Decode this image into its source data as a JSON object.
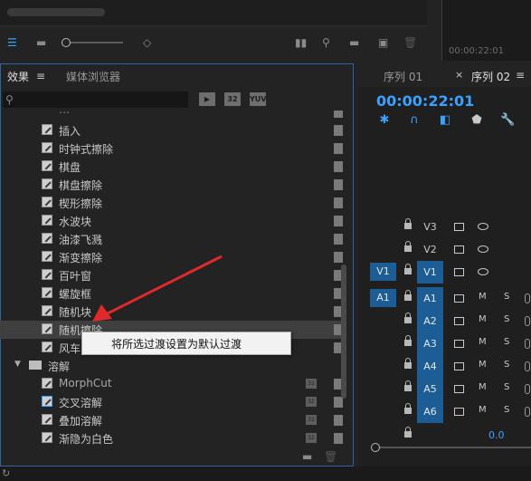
{
  "top": {
    "timecode_small": "00:00:22:01"
  },
  "effects_panel": {
    "tab_effects": "效果",
    "tab_media_browser": "媒体浏览器",
    "search_placeholder": "",
    "filter_buttons": [
      "32",
      "YUV"
    ],
    "items": [
      {
        "label": "插入"
      },
      {
        "label": "时钟式擦除"
      },
      {
        "label": "棋盘"
      },
      {
        "label": "棋盘擦除"
      },
      {
        "label": "楔形擦除"
      },
      {
        "label": "水波块"
      },
      {
        "label": "油漆飞溅"
      },
      {
        "label": "渐变擦除"
      },
      {
        "label": "百叶窗"
      },
      {
        "label": "螺旋框"
      },
      {
        "label": "随机块"
      },
      {
        "label": "随机擦除"
      },
      {
        "label": "风车"
      }
    ],
    "folder": "溶解",
    "dissolve_items": [
      {
        "label": "MorphCut"
      },
      {
        "label": "交叉溶解"
      },
      {
        "label": "叠加溶解"
      },
      {
        "label": "渐隐为白色"
      }
    ],
    "context_menu_item": "将所选过渡设置为默认过渡"
  },
  "sequence_panel": {
    "tab_seq1": "序列 01",
    "tab_seq2": "序列 02",
    "timecode": "00:00:22:01",
    "zero_value": "0.0",
    "video_tracks": [
      {
        "src": "",
        "target": "V3"
      },
      {
        "src": "",
        "target": "V2"
      },
      {
        "src": "V1",
        "target": "V1"
      }
    ],
    "audio_tracks": [
      {
        "src": "A1",
        "target": "A1"
      },
      {
        "src": "",
        "target": "A2"
      },
      {
        "src": "",
        "target": "A3"
      },
      {
        "src": "",
        "target": "A4"
      },
      {
        "src": "",
        "target": "A5"
      },
      {
        "src": "",
        "target": "A6"
      }
    ],
    "mute_label": "M",
    "solo_label": "S"
  },
  "colors": {
    "accent": "#3ca0ff",
    "track_blue": "#1d5d96",
    "panel_focus_border": "#2d64a8"
  }
}
